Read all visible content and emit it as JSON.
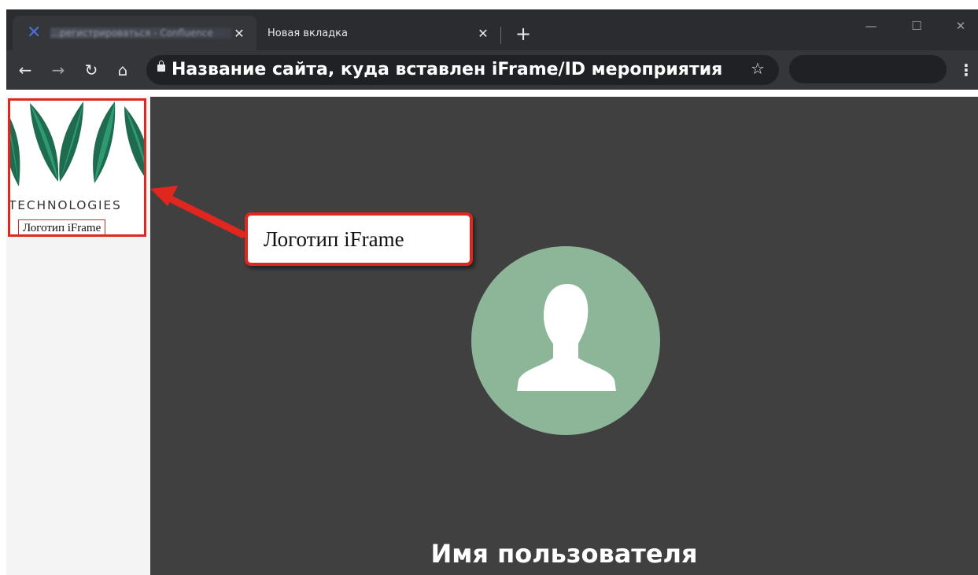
{
  "browser": {
    "tabs": [
      {
        "title": "…регистрироваться - Confluence",
        "favicon": "confluence-x-icon",
        "active": true
      },
      {
        "title": "Новая вкладка",
        "favicon": "",
        "active": false
      }
    ],
    "new_tab_label": "+",
    "close_glyph": "✕",
    "window_controls": {
      "minimize": "—",
      "maximize": "☐",
      "close": "✕"
    },
    "nav": {
      "back": "←",
      "forward": "→",
      "reload": "↻",
      "home": "⌂"
    },
    "url": "Название сайта, куда вставлен iFrame/ID мероприятия",
    "star_glyph": "☆",
    "menu_glyph": "⋮"
  },
  "sidebar": {
    "logo_text": "TECHNOLOGIES",
    "logo_label": "Логотип iFrame"
  },
  "annotation": {
    "callout_text": "Логотип iFrame",
    "border_color": "#e0271f"
  },
  "main": {
    "user_name": "Имя пользователя",
    "avatar_color": "#8db598"
  },
  "colors": {
    "leaf_dark": "#1e6b50",
    "leaf_light": "#2f9a72",
    "tab_bar": "#2b2c2f",
    "toolbar": "#35363a",
    "content_bg": "#404040"
  }
}
